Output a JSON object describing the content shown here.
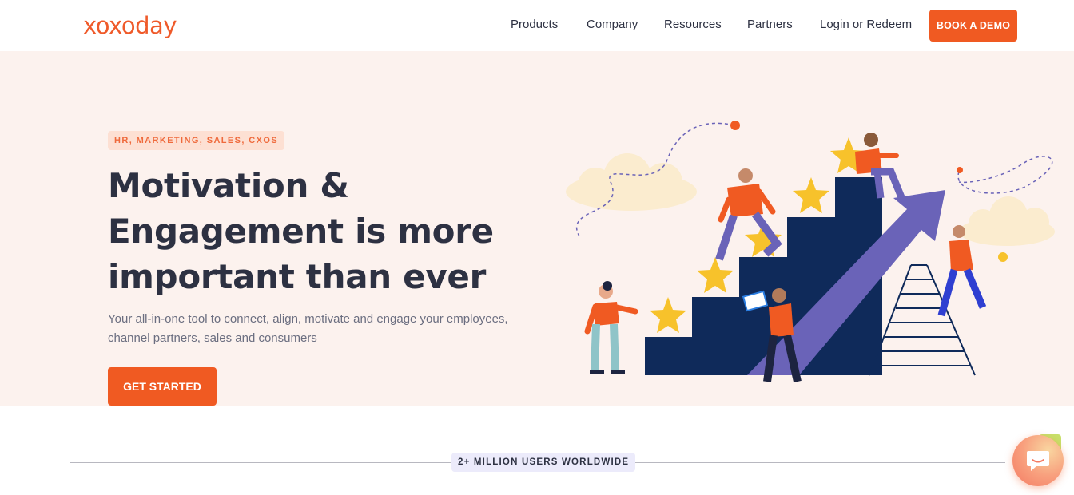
{
  "header": {
    "logo_text": "xoxoday",
    "nav": [
      "Products",
      "Company",
      "Resources",
      "Partners",
      "Login or Redeem"
    ],
    "demo_button": "BOOK A DEMO"
  },
  "hero": {
    "badge": "HR, MARKETING, SALES, CXOS",
    "title": "Motivation & Engagement is more important than ever",
    "subtitle": "Your all-in-one tool to connect, align, motivate and engage your employees, channel partners, sales and consumers",
    "cta": "GET STARTED"
  },
  "stats": {
    "users_badge": "2+ MILLION USERS WORLDWIDE"
  },
  "colors": {
    "brand_orange": "#f05a22",
    "hero_bg": "#fcf2ee",
    "navy": "#0f2a5a",
    "purple_arrow": "#6a63b8",
    "star_yellow": "#f7c22b"
  },
  "icons": [
    "chat-icon"
  ]
}
